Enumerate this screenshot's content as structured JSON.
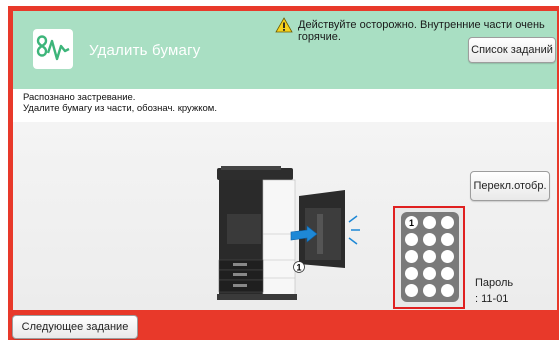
{
  "header": {
    "title": "Удалить бумагу",
    "warning": "Действуйте осторожно. Внутренние части очень горячие.",
    "job_list_label": "Список заданий"
  },
  "message": {
    "line1": "Распознано застревание.",
    "line2": "Удалите бумагу из части, обознач. кружком."
  },
  "controls": {
    "toggle_view_label": "Перекл.отобр.",
    "next_job_label": "Следующее задание"
  },
  "jam": {
    "marker": "1",
    "keypad_marker": "1",
    "password_label": "Пароль",
    "password_value": ": 11-01"
  },
  "colors": {
    "frame": "#e8392a",
    "header": "#a9dfc3",
    "highlight": "#e02020",
    "arrow": "#1e88d6"
  },
  "icons": [
    "warning-icon",
    "jam-logo-icon",
    "printer-illustration",
    "numeric-keypad"
  ]
}
